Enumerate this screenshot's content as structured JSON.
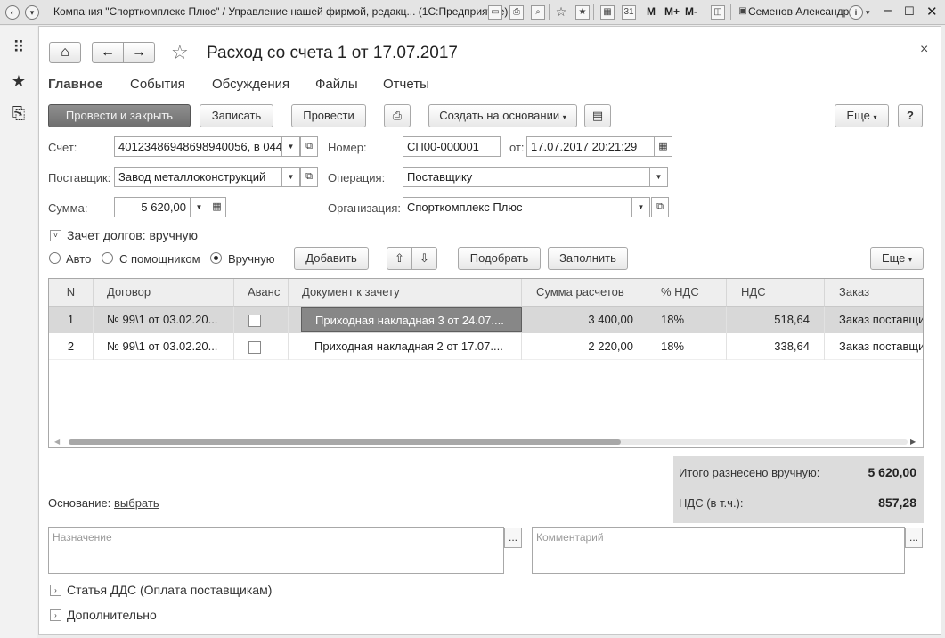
{
  "window": {
    "title": "Компания \"Спорткомплекс Плюс\" / Управление нашей фирмой, редакц...  (1С:Предприятие)",
    "user": "Семенов Александр",
    "m_labels": [
      "M",
      "M+",
      "M-"
    ]
  },
  "form": {
    "title": "Расход со счета 1 от 17.07.2017",
    "tabs": [
      "Главное",
      "События",
      "Обсуждения",
      "Файлы",
      "Отчеты"
    ],
    "toolbar": {
      "post_close": "Провести и закрыть",
      "save": "Записать",
      "post": "Провести",
      "create_based": "Создать на основании",
      "more": "Еще",
      "help": "?"
    },
    "fields": {
      "account_label": "Счет:",
      "account_value": "40123486948698940056, в 044",
      "number_label": "Номер:",
      "number_value": "СП00-000001",
      "date_label": "от:",
      "date_value": "17.07.2017 20:21:29",
      "supplier_label": "Поставщик:",
      "supplier_value": "Завод металлоконструкций",
      "operation_label": "Операция:",
      "operation_value": "Поставщику",
      "sum_label": "Сумма:",
      "sum_value": "5 620,00",
      "org_label": "Организация:",
      "org_value": "Спорткомплекс Плюс"
    },
    "offset": {
      "group_title": "Зачет долгов: вручную",
      "radio_auto": "Авто",
      "radio_helper": "С помощником",
      "radio_manual": "Вручную",
      "add": "Добавить",
      "pick": "Подобрать",
      "fill": "Заполнить",
      "more": "Еще"
    },
    "table": {
      "columns": [
        "N",
        "Договор",
        "Аванс",
        "Документ к зачету",
        "Сумма расчетов",
        "% НДС",
        "НДС",
        "Заказ"
      ],
      "rows": [
        {
          "n": "1",
          "contract": "№ 99\\1 от 03.02.20...",
          "advance": false,
          "document": "Приходная накладная 3 от 24.07....",
          "amount": "3 400,00",
          "vat_rate": "18%",
          "vat": "518,64",
          "order": "Заказ поставщи"
        },
        {
          "n": "2",
          "contract": "№ 99\\1 от 03.02.20...",
          "advance": false,
          "document": "Приходная накладная 2 от 17.07....",
          "amount": "2 220,00",
          "vat_rate": "18%",
          "vat": "338,64",
          "order": "Заказ поставщи"
        }
      ]
    },
    "totals": {
      "total_label": "Итого разнесено вручную:",
      "total_value": "5 620,00",
      "vat_label": "НДС (в т.ч.):",
      "vat_value": "857,28"
    },
    "basis": {
      "label": "Основание:",
      "link": "выбрать"
    },
    "purpose_placeholder": "Назначение",
    "comment_placeholder": "Комментарий",
    "dds_group": "Статья ДДС (Оплата поставщикам)",
    "extra_group": "Дополнительно"
  }
}
